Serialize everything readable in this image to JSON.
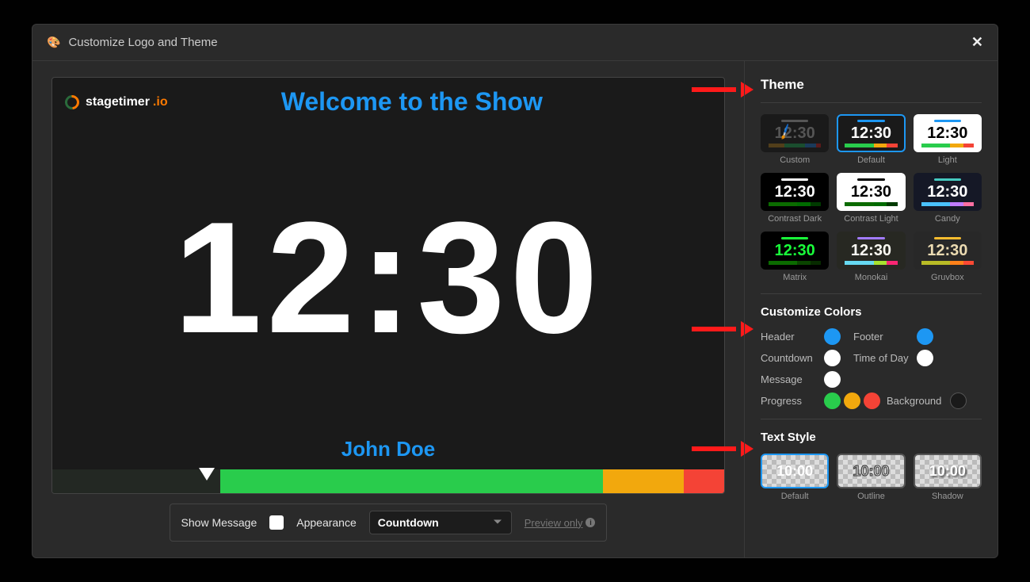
{
  "modal": {
    "title": "Customize Logo and Theme"
  },
  "logo": {
    "text1": "stagetimer",
    "text2": ".io"
  },
  "preview": {
    "headline": "Welcome to the Show",
    "time": "12:30",
    "footer": "John Doe"
  },
  "controls": {
    "show_message_label": "Show Message",
    "appearance_label": "Appearance",
    "appearance_value": "Countdown",
    "preview_only_label": "Preview only"
  },
  "sections": {
    "theme_title": "Theme",
    "colors_title": "Customize Colors",
    "textstyle_title": "Text Style"
  },
  "themes": {
    "sample_time": "12:30",
    "custom": {
      "label": "Custom"
    },
    "default": {
      "label": "Default"
    },
    "light": {
      "label": "Light"
    },
    "cdark": {
      "label": "Contrast Dark"
    },
    "clight": {
      "label": "Contrast Light"
    },
    "candy": {
      "label": "Candy"
    },
    "matrix": {
      "label": "Matrix"
    },
    "monokai": {
      "label": "Monokai"
    },
    "gruvbox": {
      "label": "Gruvbox"
    }
  },
  "colors": {
    "header_label": "Header",
    "footer_label": "Footer",
    "countdown_label": "Countdown",
    "timeofday_label": "Time of Day",
    "message_label": "Message",
    "progress_label": "Progress",
    "background_label": "Background",
    "header": "#1d97f3",
    "footer": "#1d97f3",
    "countdown": "#ffffff",
    "timeofday": "#ffffff",
    "message": "#ffffff",
    "progress": [
      "#29cc4c",
      "#f2a80d",
      "#f44336"
    ],
    "background": "#1a1a1a"
  },
  "textstyles": {
    "sample": "10:00",
    "default": {
      "label": "Default"
    },
    "outline": {
      "label": "Outline"
    },
    "shadow": {
      "label": "Shadow"
    }
  }
}
